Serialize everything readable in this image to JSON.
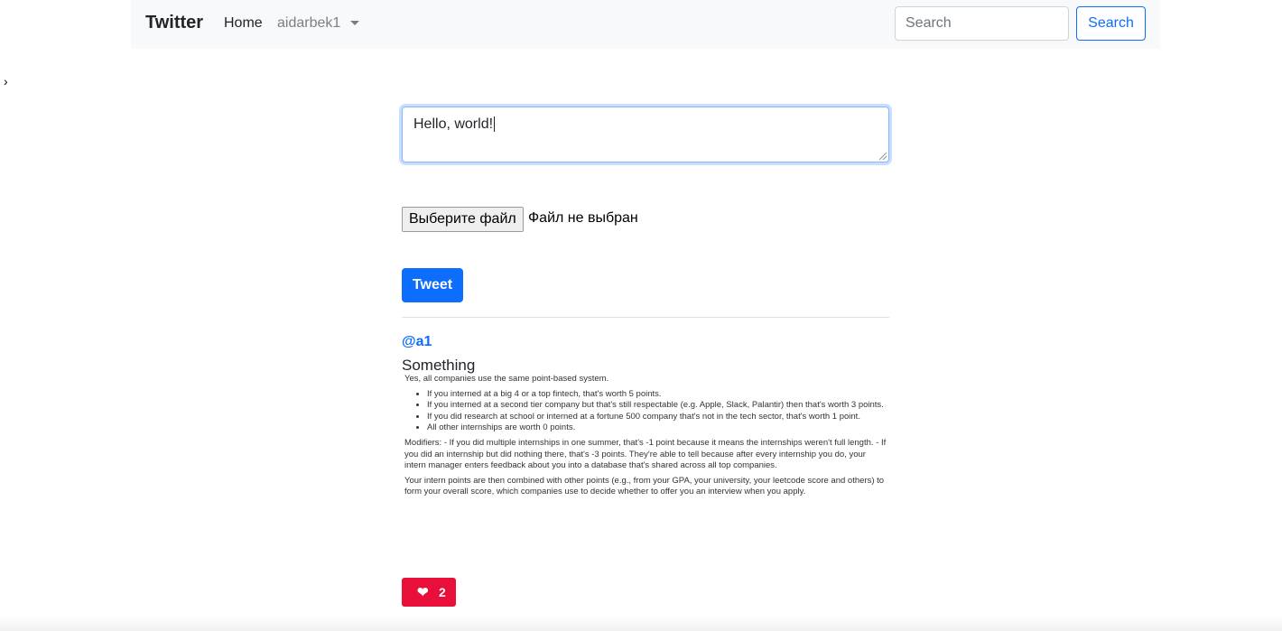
{
  "navbar": {
    "brand": "Twitter",
    "home": "Home",
    "user": "aidarbek1",
    "search_placeholder": "Search",
    "search_button": "Search"
  },
  "stray_char": "›",
  "composer": {
    "text": "Hello, world!",
    "file_button": "Выберите файл",
    "file_status": "Файл не выбран",
    "tweet_button": "Tweet"
  },
  "post": {
    "handle": "@a1",
    "title": "Something",
    "image_text": {
      "intro": "Yes, all companies use the same point-based system.",
      "bullets": [
        "If you interned at a big 4 or a top fintech, that's worth 5 points.",
        "If you interned at a second tier company but that's still respectable (e.g. Apple, Slack, Palantir) then that's worth 3 points.",
        "If you did research at school or interned at a fortune 500 company that's not in the tech sector, that's worth 1 point.",
        "All other internships are worth 0 points."
      ],
      "modifiers": "Modifiers: - If you did multiple internships in one summer, that's -1 point because it means the internships weren't full length. - If you did an internship but did nothing there, that's -3 points. They're able to tell because after every internship you do, your intern manager enters feedback about you into a database that's shared across all top companies.",
      "closing": "Your intern points are then combined with other points (e.g., from your GPA, your university, your leetcode score and others) to form your overall score, which companies use to decide whether to offer you an interview when you apply."
    },
    "likes": "2",
    "like_icon": "heart-icon",
    "like_color": "#e8103a"
  }
}
